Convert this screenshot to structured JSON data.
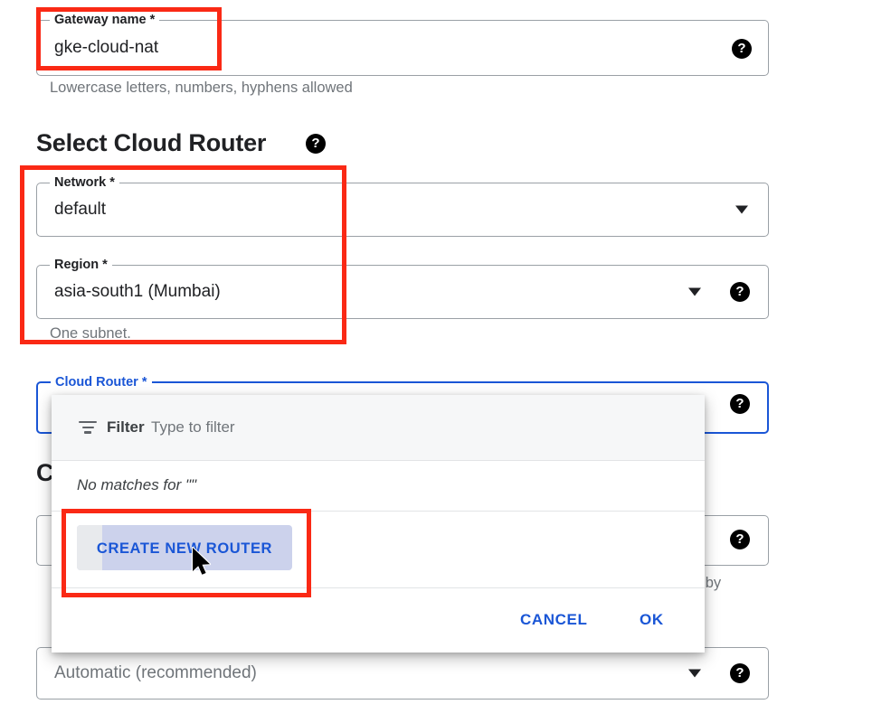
{
  "form": {
    "gateway_name": {
      "label": "Gateway name *",
      "value": "gke-cloud-nat",
      "helper": "Lowercase letters, numbers, hyphens allowed",
      "help_icon": "help-icon"
    },
    "section_heading": {
      "title": "Select Cloud Router",
      "help_icon": "help-icon"
    },
    "network": {
      "label": "Network *",
      "value": "default",
      "caret_icon": "chevron-down-icon"
    },
    "region": {
      "label": "Region *",
      "value": "asia-south1 (Mumbai)",
      "helper": "One subnet.",
      "caret_icon": "chevron-down-icon",
      "help_icon": "help-icon"
    },
    "cloud_router": {
      "label": "Cloud Router *",
      "value": "",
      "help_icon": "help-icon"
    },
    "obscured_heading": "C",
    "obscured_helper": "d by",
    "nat_ip": {
      "value": "Automatic (recommended)",
      "caret_icon": "chevron-down-icon",
      "help_icon": "help-icon"
    }
  },
  "dialog": {
    "filter": {
      "icon": "filter-icon",
      "label": "Filter",
      "placeholder": "Type to filter",
      "value": ""
    },
    "no_matches": "No matches for \"\"",
    "create_button": "CREATE NEW ROUTER",
    "cancel_button": "CANCEL",
    "ok_button": "OK"
  },
  "colors": {
    "accent_blue": "#1a56d6",
    "annotation_red": "#fa2915",
    "border_grey": "#9aa0a6",
    "helper_grey": "#70757a"
  }
}
